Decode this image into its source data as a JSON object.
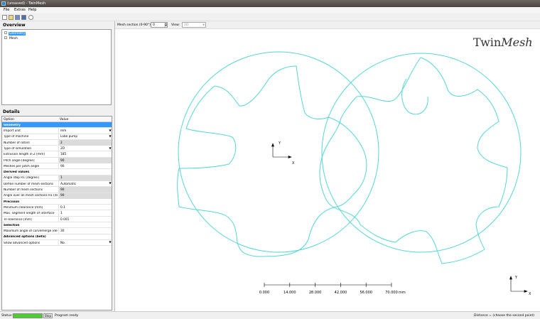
{
  "window": {
    "title": "(unsaved) - TwinMesh"
  },
  "menu": {
    "file": "File",
    "extras": "Extras",
    "help": "Help"
  },
  "overview": {
    "heading": "Overview",
    "tree": [
      {
        "label": "Geometry",
        "selected": true
      },
      {
        "label": "Mesh",
        "selected": false
      }
    ]
  },
  "details": {
    "heading": "Details",
    "col_option": "Option",
    "col_value": "Value",
    "rows": [
      {
        "kind": "cat",
        "option": "Geometry",
        "highlight": true
      },
      {
        "option": "Import unit",
        "value": "mm",
        "dropdown": true
      },
      {
        "option": "Type of machine",
        "value": "Lobe pump",
        "dropdown": true
      },
      {
        "option": "Number of rotors",
        "value": "2",
        "grey": true
      },
      {
        "option": "Type of simulation",
        "value": "2D",
        "dropdown": true
      },
      {
        "option": "Extrusion length in Z [mm]",
        "value": "185"
      },
      {
        "option": "Pitch angle [degree]",
        "value": "90",
        "grey": true
      },
      {
        "option": "Meshes per pitch angle",
        "value": "90"
      },
      {
        "kind": "cat",
        "option": "Derived values"
      },
      {
        "option": "Angle step R1 [degree]",
        "value": "1",
        "grey": true
      },
      {
        "option": "Define number of mesh sections",
        "value": "Automatic",
        "dropdown": true
      },
      {
        "option": "Number of mesh sections",
        "value": "90",
        "grey": true
      },
      {
        "option": "Angle over all mesh sections R1 [degr.",
        "value": "90",
        "grey": true
      },
      {
        "kind": "cat",
        "option": "Precision"
      },
      {
        "option": "Minimum clearance [mm]",
        "value": "0.1"
      },
      {
        "option": "Max. segment length of interface",
        "value": "1"
      },
      {
        "option": "Tri-Tolerance [mm]",
        "value": "0.001"
      },
      {
        "kind": "cat",
        "option": "Selection"
      },
      {
        "option": "Maximum angle of curvemerge [degree]",
        "value": "30"
      },
      {
        "kind": "cat",
        "option": "Advanced options (beta)"
      },
      {
        "option": "Show advanced options",
        "value": "No",
        "dropdown": true
      }
    ]
  },
  "main": {
    "mesh_section_label": "Mesh section (0-90°)",
    "mesh_section_value": "0",
    "view_label": "View:",
    "view_value": "2D",
    "logo_a": "Twin",
    "logo_b": "Mesh",
    "axis_x": "X",
    "axis_y": "Y",
    "scale_ticks": [
      "0.000",
      "14.000",
      "28.000",
      "42.000",
      "56.000",
      "70.000"
    ],
    "scale_unit": "mm"
  },
  "status": {
    "label": "Status:",
    "stop": "Stop",
    "message": "Program ready",
    "distance": "Distance = (choose the second point)"
  },
  "colors": {
    "mesh": "#55d6d6",
    "selection": "#3399ff",
    "progress": "#4ccd30"
  }
}
